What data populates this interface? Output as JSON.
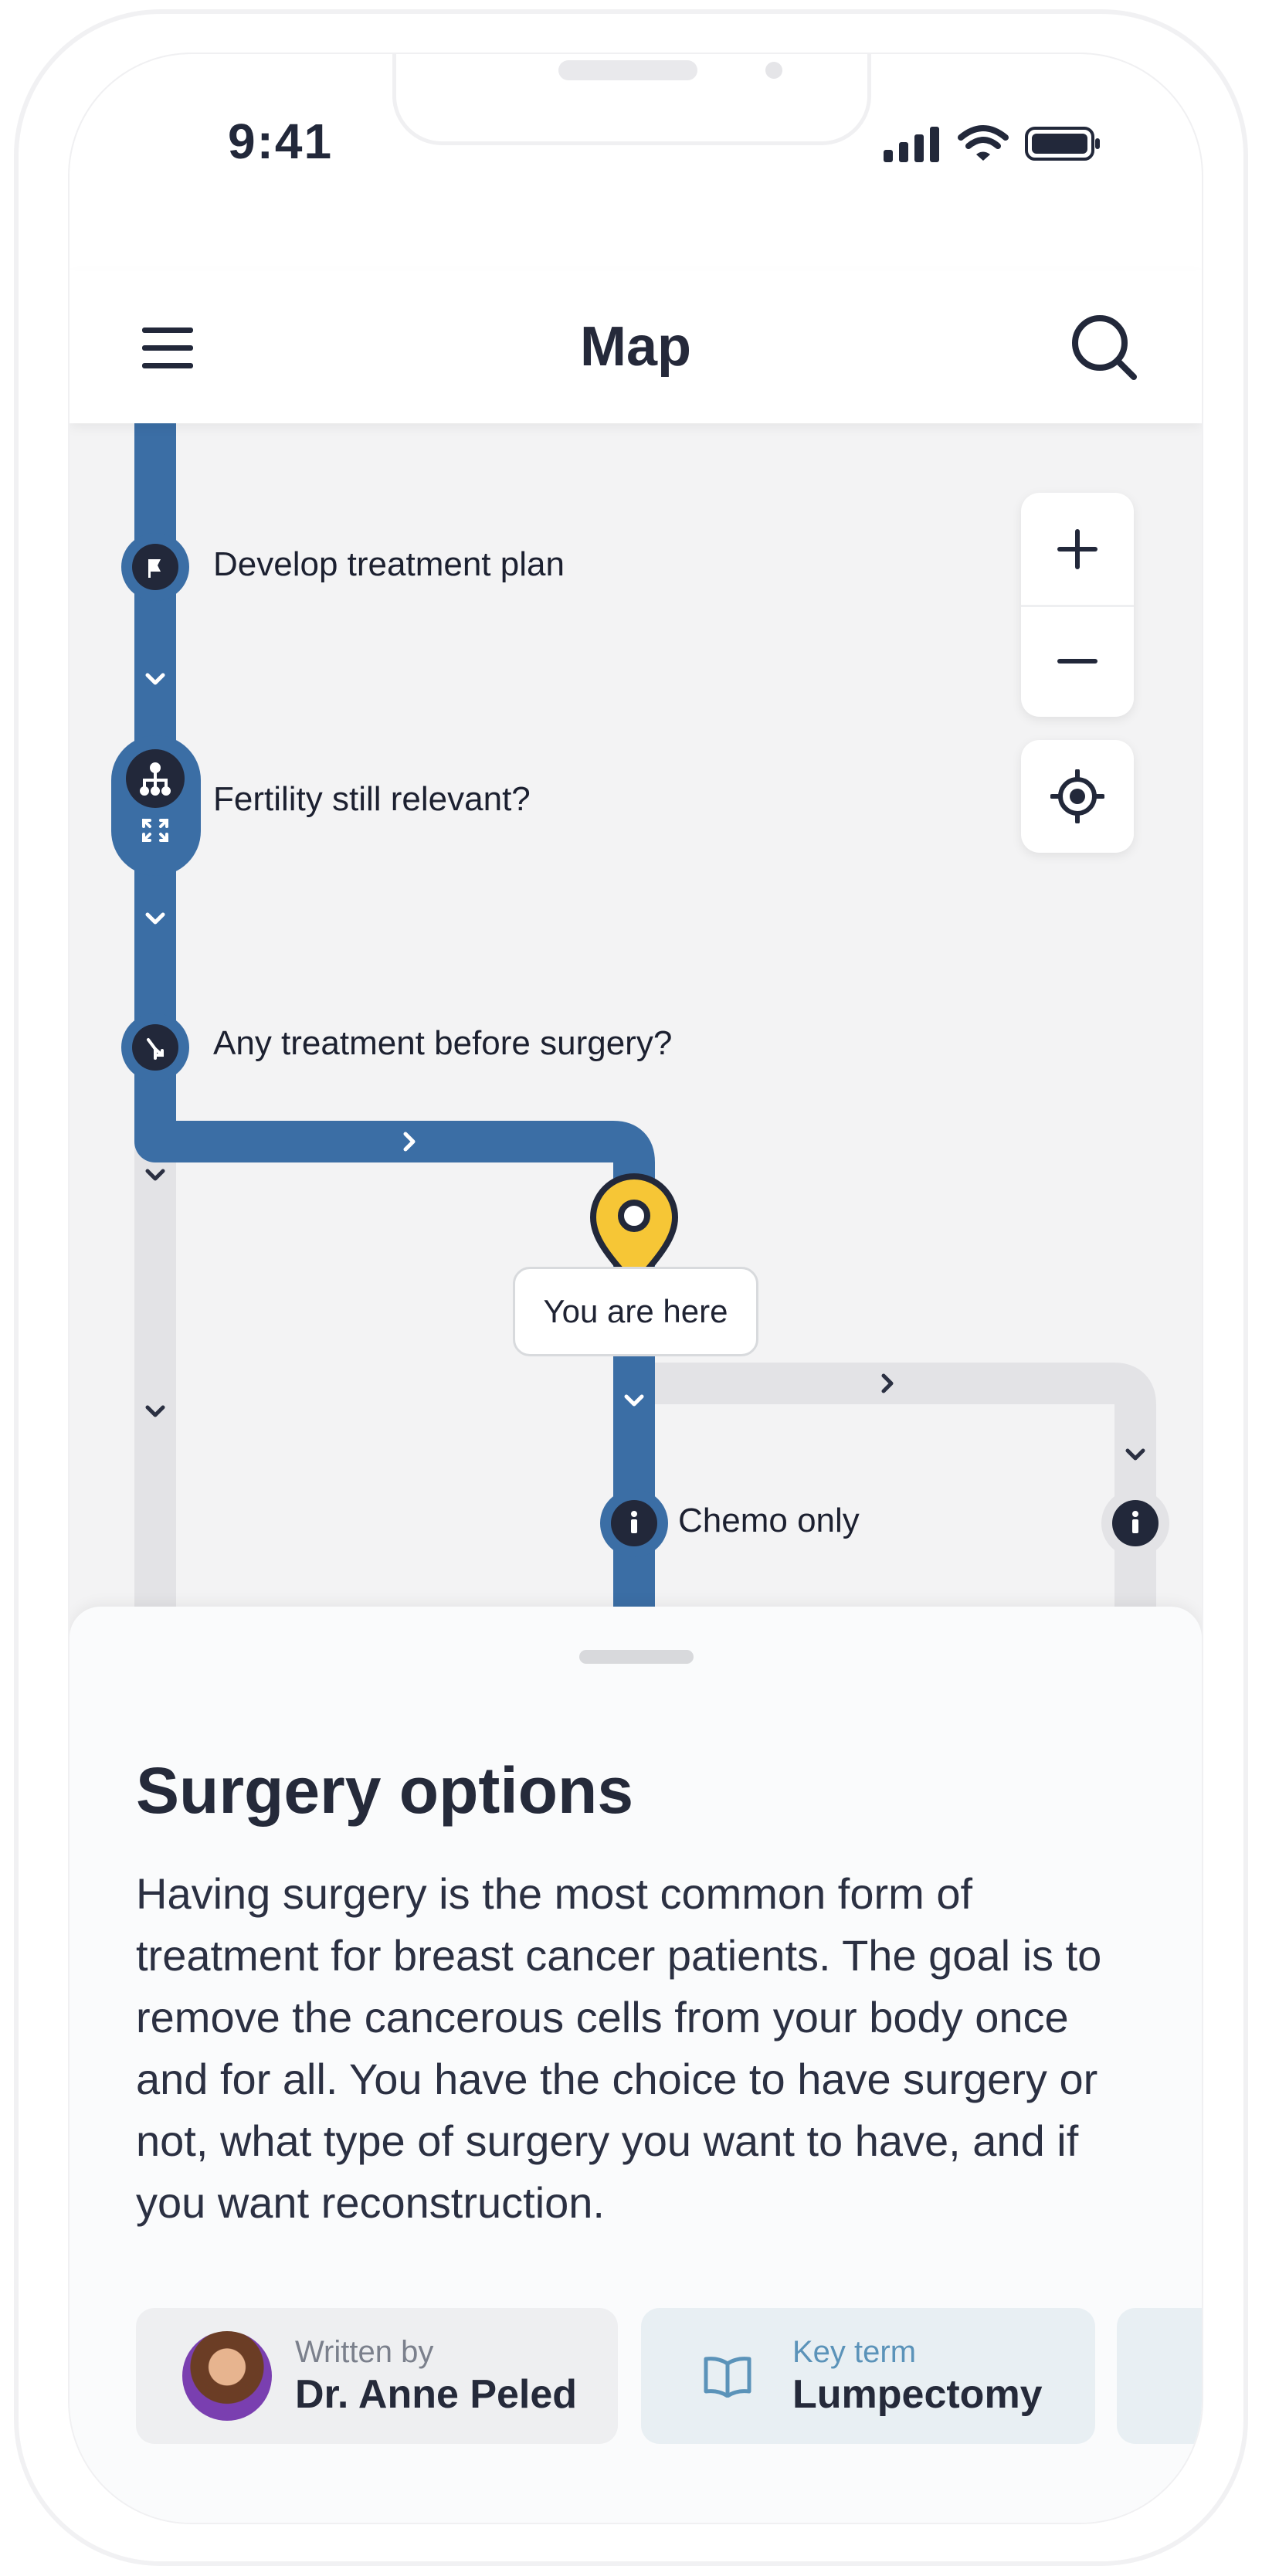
{
  "status_bar": {
    "time": "9:41"
  },
  "header": {
    "title": "Map"
  },
  "map": {
    "nodes": [
      {
        "label": "Develop treatment plan",
        "icon": "flag-icon"
      },
      {
        "label": "Fertility still relevant?",
        "icon": "hierarchy-icon"
      },
      {
        "label": "Any treatment before surgery?",
        "icon": "split-icon"
      },
      {
        "label": "Chemo only",
        "icon": "info-icon"
      }
    ],
    "you_are_here": "You are here",
    "colors": {
      "active_path": "#3c6fa5",
      "inactive_path": "#e4e4e7",
      "marker": "#f6c636",
      "node": "#22283a"
    }
  },
  "sheet": {
    "title": "Surgery options",
    "body": "Having surgery is the most common form of treatment for breast cancer patients. The goal is to remove the cancerous cells from your body once and for all. You have the choice to have surgery or not, what type of surgery you want to have, and if you want reconstruction.",
    "author": {
      "label": "Written by",
      "name": "Dr. Anne Peled"
    },
    "key_term": {
      "label": "Key term",
      "term": "Lumpectomy"
    }
  }
}
